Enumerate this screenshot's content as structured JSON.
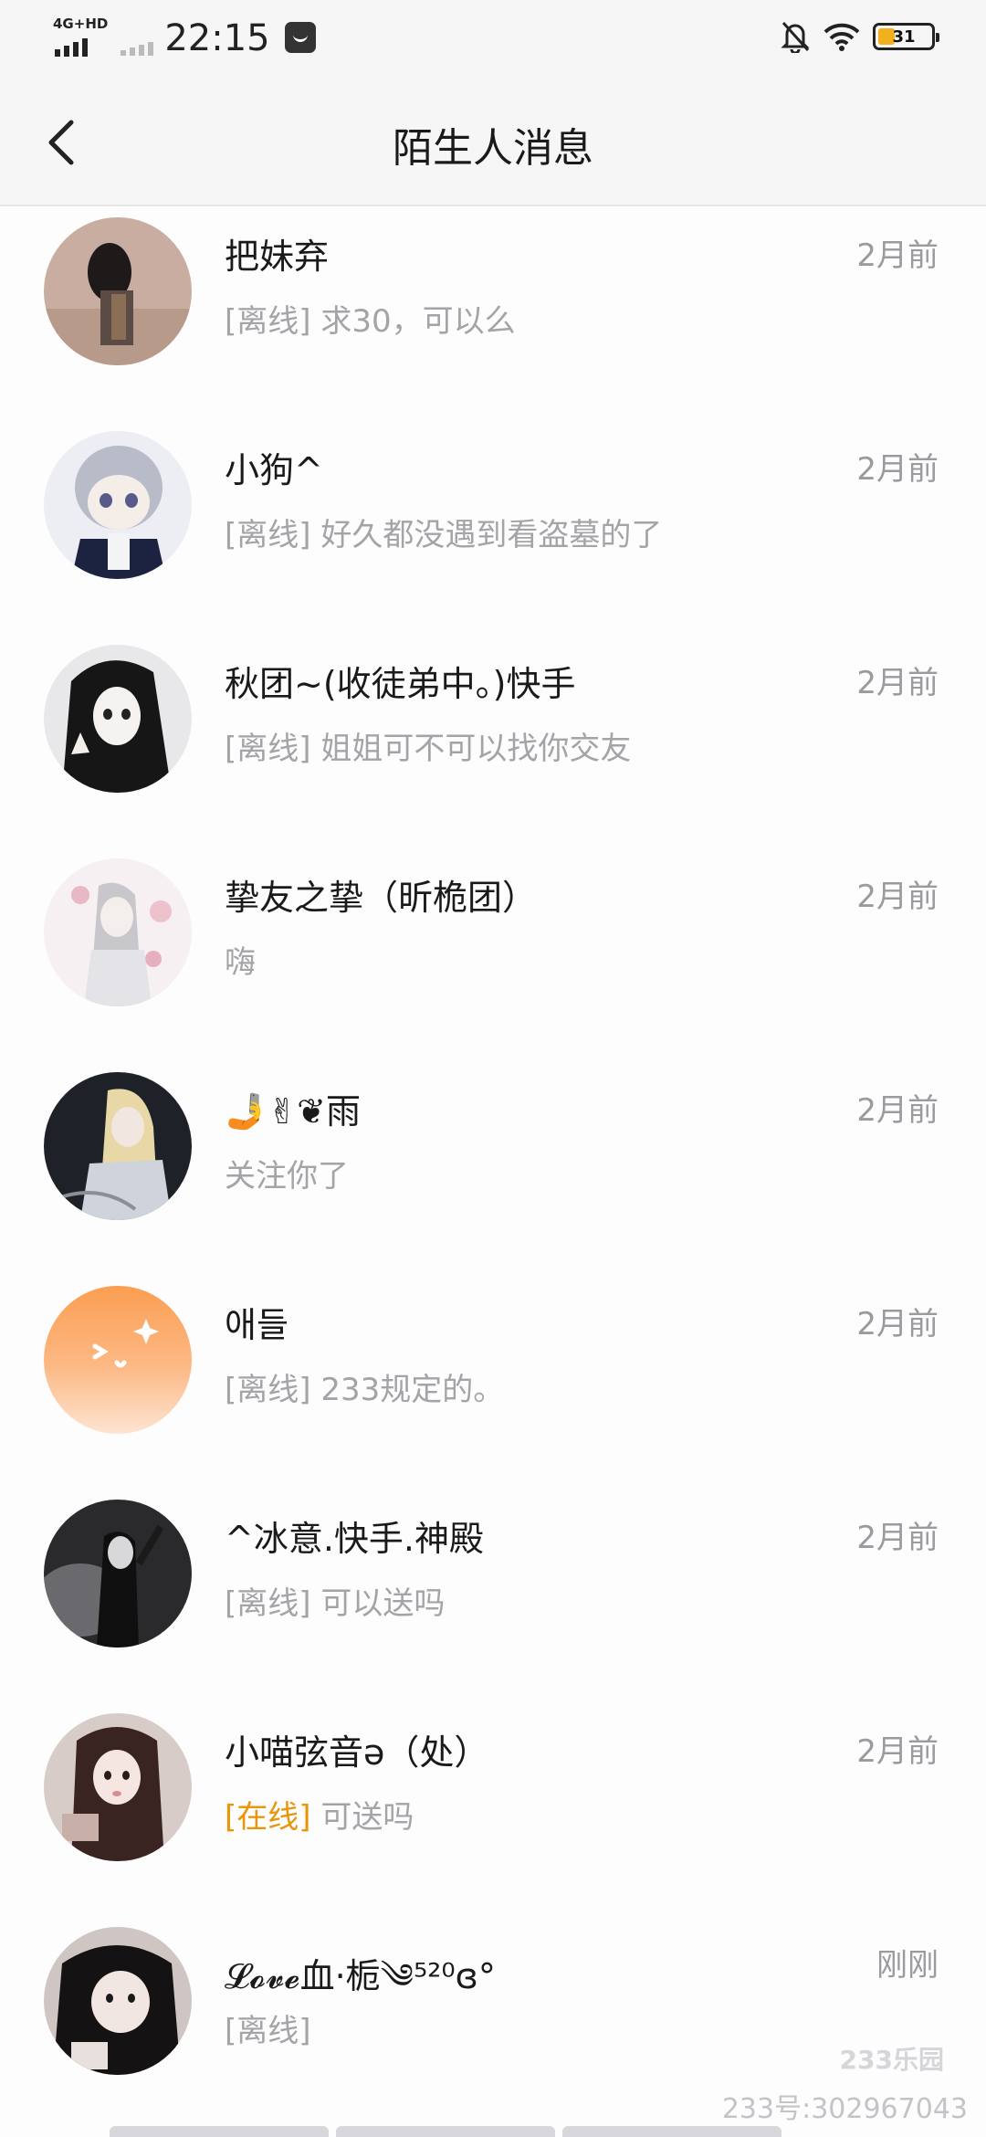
{
  "status_bar": {
    "network_badge": "4G+HD",
    "time": "22:15",
    "battery": "31",
    "icons": [
      "signal-icon",
      "message-icon",
      "mute-bell-icon",
      "wifi-icon",
      "battery-icon"
    ]
  },
  "header": {
    "title": "陌生人消息",
    "back_icon": "back-chevron-icon"
  },
  "conversations": [
    {
      "name": "把妹弃",
      "time": "2月前",
      "status": "[离线]",
      "preview": " 求30，可以么"
    },
    {
      "name": "小狗^",
      "time": "2月前",
      "status": "[离线]",
      "preview": " 好久都没遇到看盗墓的了"
    },
    {
      "name": "秋团~(收徒弟中。)快手",
      "time": "2月前",
      "status": "[离线]",
      "preview": " 姐姐可不可以找你交友"
    },
    {
      "name": "挚友之挚（昕桅团）",
      "time": "2月前",
      "status": "",
      "preview": "嗨"
    },
    {
      "name": "🤳✌❦雨",
      "time": "2月前",
      "status": "",
      "preview": "关注你了"
    },
    {
      "name": "애들",
      "time": "2月前",
      "status": "[离线]",
      "preview": " 233规定的。"
    },
    {
      "name": "^冰意.快手.神殿",
      "time": "2月前",
      "status": "[离线]",
      "preview": " 可以送吗"
    },
    {
      "name": "小喵弦音ə（处）",
      "time": "2月前",
      "status": "[在线]",
      "preview": " 可送吗"
    },
    {
      "name": "𝓛𝓸𝓿𝓮血·栀༄⁵²⁰ɞ°",
      "time": "刚刚",
      "status": "[离线]",
      "preview": ""
    }
  ],
  "watermark": {
    "logo": "233乐园",
    "id_text": "233号:302967043"
  },
  "colors": {
    "online": "#e8960a",
    "muted_text": "#a4a4a8",
    "battery": "#f2b01e"
  }
}
